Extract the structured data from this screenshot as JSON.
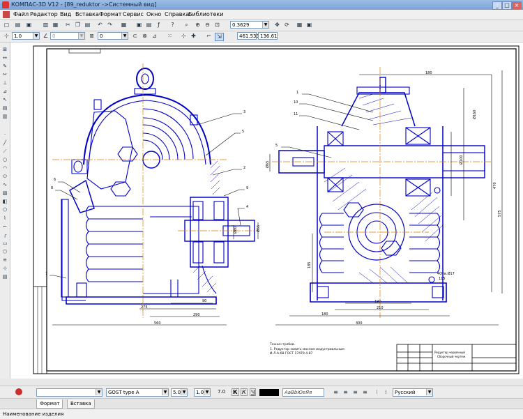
{
  "window": {
    "title": "КОМПАС-3D V12 - [89_reduktor ->Системный вид]"
  },
  "menu": [
    "Файл",
    "Редактор",
    "Вид",
    "Вставка",
    "Формат",
    "Сервис",
    "Окно",
    "Справка",
    "Библиотеки"
  ],
  "toolbar1": {
    "zoom_value": "0.3629"
  },
  "toolbar2": {
    "step_value": "1.0",
    "angle_value": "0",
    "layer_value": "0",
    "coord_x": "461.533",
    "coord_y": "136.61"
  },
  "text_props": {
    "font_name": "GOST type A",
    "font_height": "5.0",
    "narrowing": "1.0",
    "step": "7.0",
    "bold_label": "К",
    "italic_label": "К",
    "underline_label": "Ч",
    "font_sample": "АаВbЮеЯя",
    "language": "Русский"
  },
  "tabs": [
    "Формат",
    "Вставка"
  ],
  "status": {
    "text": "Наименование изделия"
  },
  "drawing": {
    "left_view_labels": {
      "c3": "3",
      "c2": "2",
      "c9": "9",
      "c4": "4",
      "c5": "5",
      "c6": "6",
      "c8": "8",
      "c7": "7"
    },
    "left_dims": {
      "d1": "275",
      "d2": "290",
      "d3": "560",
      "d4": "90",
      "d5": "Ø55",
      "d6": "Ø80"
    },
    "right_view_labels": {
      "c1": "1",
      "c10": "10",
      "c11": "11",
      "c5": "5"
    },
    "right_dims": {
      "top": "180",
      "d1": "Ø160",
      "d2": "Ø100",
      "d3": "400",
      "d4": "Ø65",
      "d5": "185",
      "d6": "190",
      "d7": "210",
      "d8": "180",
      "d9": "300",
      "d10": "115",
      "d11": "4Отв.Ø17",
      "d12": "470",
      "d13": "575"
    },
    "notes_title": "Технич.требов.",
    "notes_line1": "1. Редуктор залить маслом индустриальным",
    "notes_line2": "И-Л-А-68 ГОСТ 17479.4-87",
    "title_block_name": "Редуктор червячный",
    "title_block_sheet": "Сборочный чертеж"
  }
}
